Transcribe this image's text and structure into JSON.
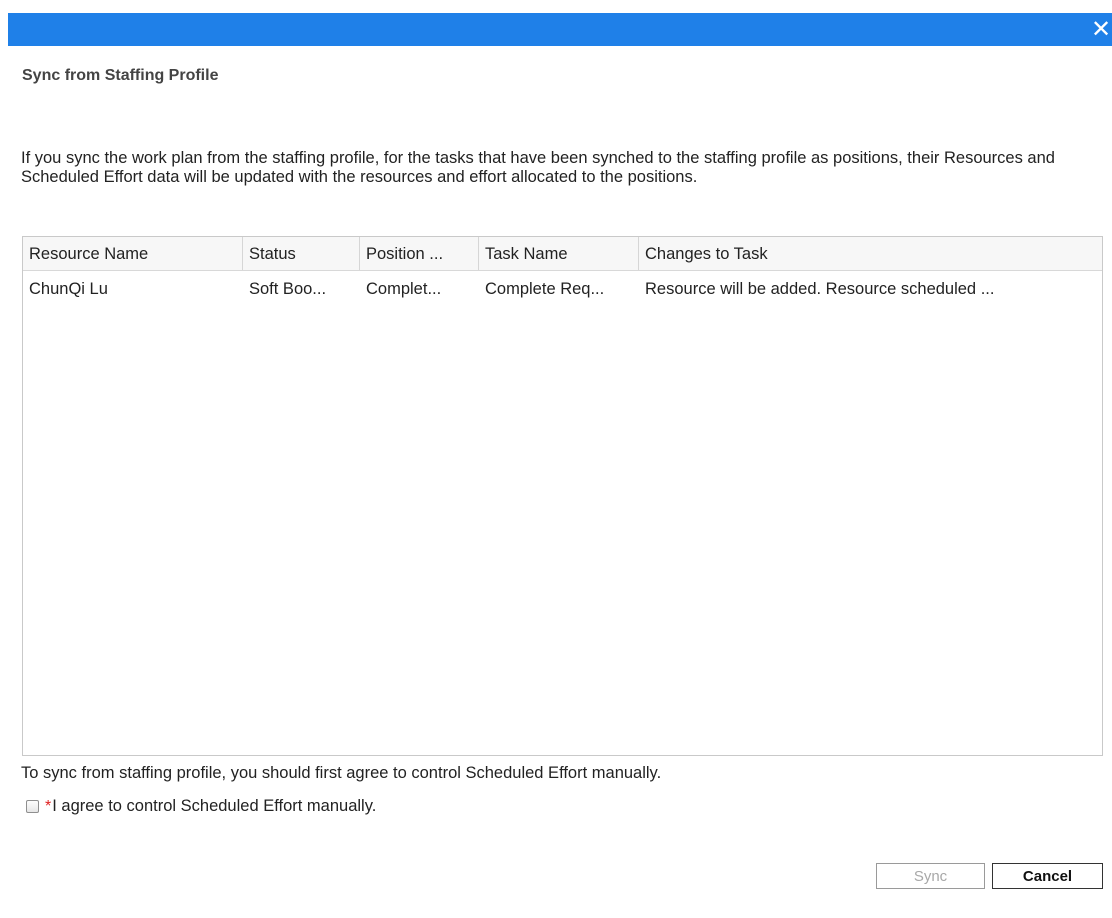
{
  "dialog": {
    "close_glyph": "✕",
    "title": "Sync from Staffing Profile",
    "description": "If you sync the work plan from the staffing profile, for the tasks that have been synched to the staffing profile as positions, their Resources and Scheduled Effort data will be updated with the resources and effort allocated to the positions."
  },
  "table": {
    "columns": [
      "Resource Name",
      "Status",
      "Position ...",
      "Task Name",
      "Changes to Task"
    ],
    "rows": [
      [
        "ChunQi Lu",
        "Soft Boo...",
        "Complet...",
        "Complete Req...",
        "Resource will be added. Resource scheduled ..."
      ]
    ]
  },
  "note": "To sync from staffing profile, you should first agree to control Scheduled Effort manually.",
  "agreement": {
    "required_marker": "*",
    "label": "I agree to control Scheduled Effort manually.",
    "checked": false
  },
  "buttons": {
    "sync_label": "Sync",
    "cancel_label": "Cancel"
  },
  "colors": {
    "titlebar": "#1f80e8",
    "required": "#e02020",
    "disabled_text": "#a8a8a8"
  }
}
